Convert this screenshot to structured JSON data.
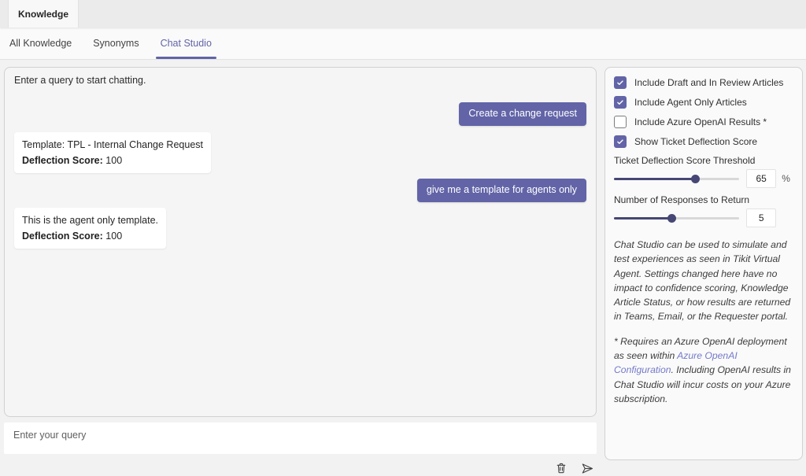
{
  "colors": {
    "accent": "#6264a7",
    "slider_fill": "#464775",
    "link": "#7479c9",
    "user_bubble": "#6264a7",
    "chat_panel_bg": "#f5f5f5"
  },
  "header": {
    "app_tab": "Knowledge"
  },
  "tabs": [
    {
      "label": "All Knowledge",
      "active": false
    },
    {
      "label": "Synonyms",
      "active": false
    },
    {
      "label": "Chat Studio",
      "active": true
    }
  ],
  "chat": {
    "intro": "Enter a query to start chatting.",
    "messages": [
      {
        "role": "user",
        "text": "Create a change request"
      },
      {
        "role": "bot",
        "line1": "Template: TPL - Internal Change Request",
        "score_label": "Deflection Score:",
        "score": "100"
      },
      {
        "role": "user",
        "text": "give me a template for agents only"
      },
      {
        "role": "bot",
        "line1": "This is the agent only template.",
        "score_label": "Deflection Score:",
        "score": "100"
      }
    ],
    "input_placeholder": "Enter your query"
  },
  "settings": {
    "checkboxes": [
      {
        "label": "Include Draft and In Review Articles",
        "checked": true
      },
      {
        "label": "Include Agent Only Articles",
        "checked": true
      },
      {
        "label": "Include Azure OpenAI Results *",
        "checked": false
      },
      {
        "label": "Show Ticket Deflection Score",
        "checked": true
      }
    ],
    "threshold": {
      "label": "Ticket Deflection Score Threshold",
      "value": "65",
      "unit": "%",
      "percent": 65
    },
    "responses": {
      "label": "Number of Responses to Return",
      "value": "5",
      "unit": "",
      "percent": 46
    },
    "note1": "Chat Studio can be used to simulate and test experiences as seen in Tikit Virtual Agent. Settings changed here have no impact to confidence scoring, Knowledge Article Status, or how results are returned in Teams, Email, or the Requester portal.",
    "note2_pre": "* Requires an Azure OpenAI deployment as seen within ",
    "note2_link": "Azure OpenAI Configuration",
    "note2_post": ". Including OpenAI results in Chat Studio will incur costs on your Azure subscription."
  }
}
